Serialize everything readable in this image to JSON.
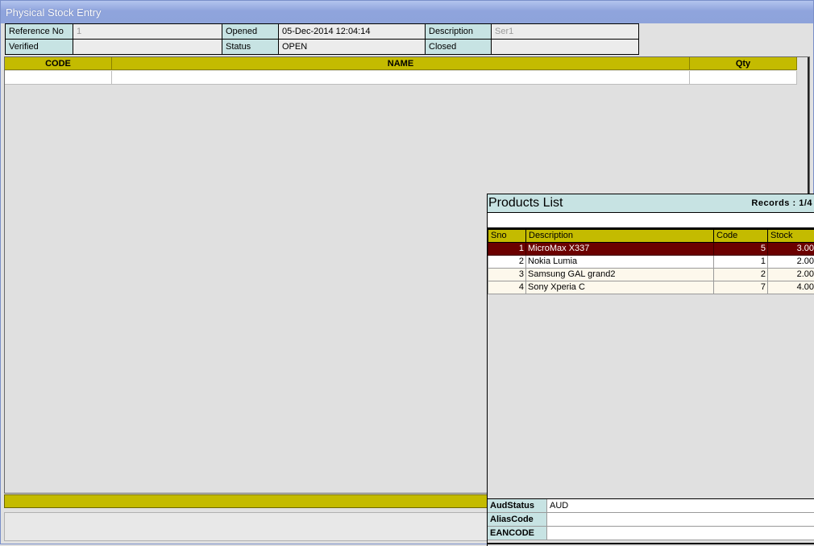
{
  "window": {
    "title": "Physical Stock Entry"
  },
  "header": {
    "reference_label": "Reference No",
    "reference_value": "1",
    "opened_label": "Opened",
    "opened_value": "05-Dec-2014 12:04:14",
    "description_label": "Description",
    "description_value": "Ser1",
    "verified_label": "Verified",
    "verified_value": "",
    "status_label": "Status",
    "status_value": "OPEN",
    "closed_label": "Closed",
    "closed_value": ""
  },
  "grid": {
    "columns": [
      "CODE",
      "NAME",
      "Qty"
    ]
  },
  "products": {
    "title": "Products List",
    "records": "Records : 1/4",
    "search_value": "",
    "columns": [
      "Sno",
      "Description",
      "Code",
      "Stock"
    ],
    "rows": [
      {
        "sno": "1",
        "description": "MicroMax X337",
        "code": "5",
        "stock": "3.00"
      },
      {
        "sno": "2",
        "description": "Nokia Lumia",
        "code": "1",
        "stock": "2.00"
      },
      {
        "sno": "3",
        "description": "Samsung GAL grand2",
        "code": "2",
        "stock": "2.00"
      },
      {
        "sno": "4",
        "description": "Sony Xperia C",
        "code": "7",
        "stock": "4.00"
      }
    ],
    "details": [
      {
        "label": "AudStatus",
        "value": "AUD"
      },
      {
        "label": "AliasCode",
        "value": ""
      },
      {
        "label": "EANCODE",
        "value": ""
      }
    ]
  },
  "colors": {
    "accent_yellow": "#c4bb00",
    "label_cyan": "#c7e3e3",
    "selected_row": "#6b0000",
    "titlebar": "#8fa4dd"
  }
}
